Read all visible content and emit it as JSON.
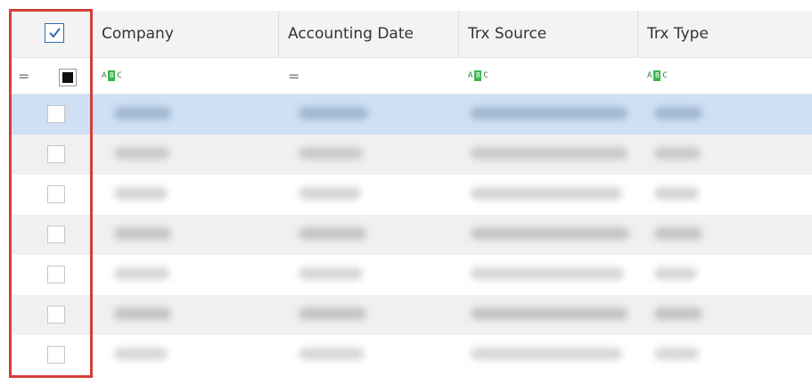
{
  "columns": {
    "company": "Company",
    "accounting_date": "Accounting Date",
    "trx_source": "Trx Source",
    "trx_type": "Trx Type"
  },
  "filter_icons": {
    "equals": "=",
    "abc_left": "A",
    "abc_right": "C"
  },
  "rows": [
    {
      "selected": false,
      "state": "selected-row"
    },
    {
      "selected": false,
      "state": "alt"
    },
    {
      "selected": false,
      "state": "normal"
    },
    {
      "selected": false,
      "state": "alt"
    },
    {
      "selected": false,
      "state": "normal"
    },
    {
      "selected": false,
      "state": "alt"
    },
    {
      "selected": false,
      "state": "normal"
    }
  ],
  "colors": {
    "accent_highlight": "#d33f3a",
    "selected_row": "#cfe0f4",
    "alt_row": "#f0f0f0"
  }
}
